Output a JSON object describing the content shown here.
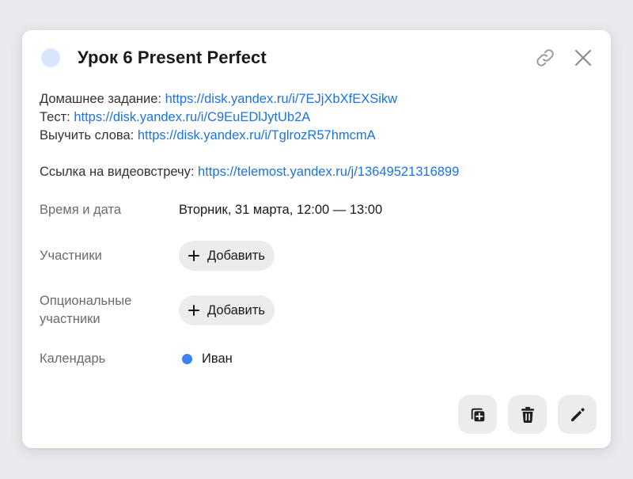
{
  "event": {
    "title": "Урок 6 Present Perfect",
    "color": "#d8e6fd"
  },
  "header_actions": {
    "link_icon": "link-icon",
    "close_icon": "close-icon"
  },
  "description": {
    "homework_label": "Домашнее задание: ",
    "homework_url": "https://disk.yandex.ru/i/7EJjXbXfEXSikw",
    "test_label": "Тест: ",
    "test_url": "https://disk.yandex.ru/i/C9EuEDlJytUb2A",
    "words_label": "Выучить слова: ",
    "words_url": "https://disk.yandex.ru/i/TglrozR57hmcmA",
    "video_label": "Ссылка на видеовстречу: ",
    "video_url": "https://telemost.yandex.ru/j/13649521316899"
  },
  "details": {
    "datetime_label": "Время и дата",
    "datetime_value": "Вторник, 31 марта, 12:00 — 13:00",
    "participants_label": "Участники",
    "participants_add": "Добавить",
    "optional_label_line1": "Опциональные",
    "optional_label_line2": "участники",
    "optional_add": "Добавить",
    "calendar_label": "Календарь",
    "calendar_value": "Иван",
    "calendar_color": "#3a83f1"
  },
  "footer_actions": {
    "duplicate_icon": "duplicate-icon",
    "delete_icon": "trash-icon",
    "edit_icon": "pencil-icon"
  }
}
